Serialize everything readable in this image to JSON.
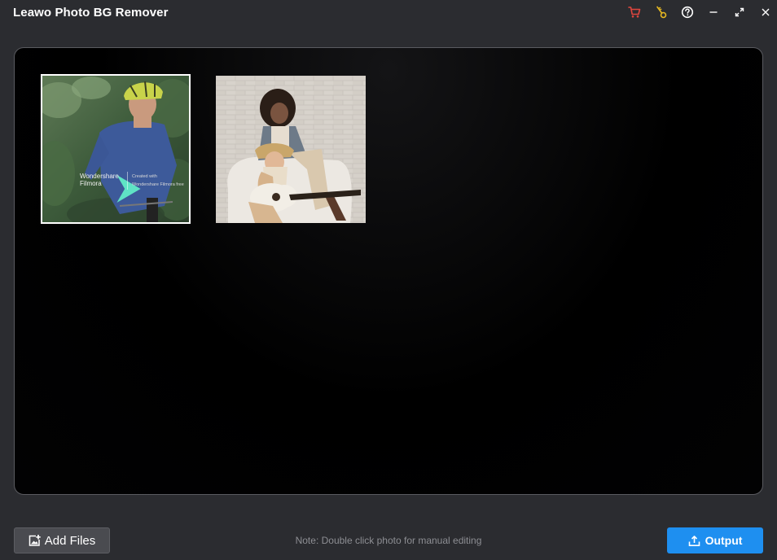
{
  "app": {
    "title": "Leawo Photo BG Remover"
  },
  "window_controls": [
    {
      "name": "cart-icon",
      "color": "#e0463e"
    },
    {
      "name": "key-icon",
      "color": "#e6b821"
    },
    {
      "name": "help-icon",
      "color": "#ffffff"
    },
    {
      "name": "minimize-icon",
      "color": "#ffffff"
    },
    {
      "name": "maximize-icon",
      "color": "#ffffff"
    },
    {
      "name": "close-icon",
      "color": "#ffffff"
    }
  ],
  "photos": [
    {
      "name": "cyclist-photo",
      "selected": true,
      "watermark": {
        "brand_line1": "Wondershare",
        "brand_line2": "Filmora",
        "created_line1": "Created with",
        "created_line2": "Wondershare Filmora free"
      }
    },
    {
      "name": "guitar-women-photo",
      "selected": false
    }
  ],
  "footer": {
    "add_files_label": "Add Files",
    "note": "Note: Double click photo for manual editing",
    "output_label": "Output"
  },
  "colors": {
    "accent": "#1e8ff0",
    "background": "#2b2c30",
    "canvas": "#000000"
  }
}
